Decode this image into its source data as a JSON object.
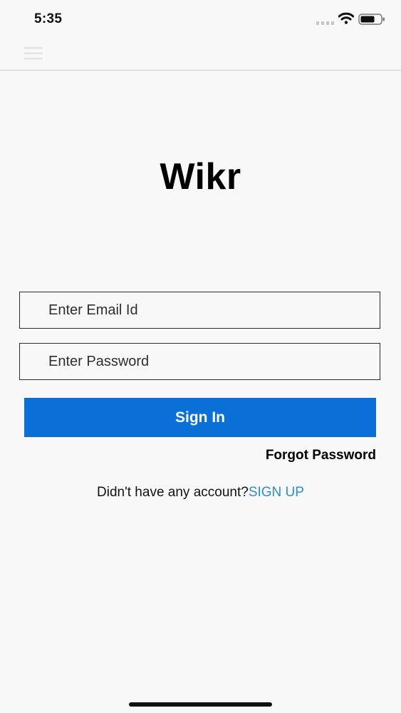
{
  "status_bar": {
    "time": "5:35",
    "icons": [
      "cellular-signal-icon",
      "wifi-icon",
      "battery-icon"
    ]
  },
  "nav_bar": {
    "menu_icon": "hamburger-menu-icon"
  },
  "app": {
    "title": "Wikr"
  },
  "login_form": {
    "email_placeholder": "Enter Email Id",
    "password_placeholder": "Enter Password",
    "sign_in_label": "Sign In",
    "forgot_password_label": "Forgot Password"
  },
  "signup_prompt": {
    "text": "Didn't have any account?",
    "link_label": "SIGN UP"
  },
  "colors": {
    "background": "#f8f8f9",
    "primary_button": "#0a6fd7",
    "link": "#2b8fd4",
    "field_border": "#2b2b2b"
  }
}
